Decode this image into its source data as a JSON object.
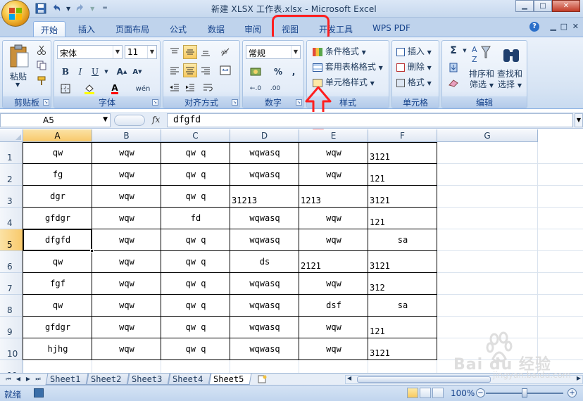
{
  "window": {
    "title": "新建 XLSX 工作表.xlsx - Microsoft Excel"
  },
  "tabs": [
    {
      "label": "开始",
      "active": true
    },
    {
      "label": "插入"
    },
    {
      "label": "页面布局"
    },
    {
      "label": "公式"
    },
    {
      "label": "数据"
    },
    {
      "label": "审阅"
    },
    {
      "label": "视图"
    },
    {
      "label": "开发工具"
    },
    {
      "label": "WPS PDF"
    }
  ],
  "ribbon": {
    "clipboard": {
      "paste_label": "粘贴",
      "group_label": "剪贴板"
    },
    "font": {
      "font_name": "宋体",
      "font_size": "11",
      "group_label": "字体"
    },
    "alignment": {
      "group_label": "对齐方式"
    },
    "number": {
      "format": "常规",
      "group_label": "数字"
    },
    "styles": {
      "conditional": "条件格式",
      "table_format": "套用表格格式",
      "cell_styles": "单元格样式",
      "group_label": "样式"
    },
    "cells": {
      "insert": "插入",
      "delete": "删除",
      "format": "格式",
      "group_label": "单元格"
    },
    "editing": {
      "sort_line1": "排序和",
      "sort_line2": "筛选",
      "find_line1": "查找和",
      "find_line2": "选择",
      "group_label": "编辑"
    }
  },
  "formula_bar": {
    "name_box": "A5",
    "fx": "fx",
    "formula": "dfgfd"
  },
  "columns": [
    "A",
    "B",
    "C",
    "D",
    "E",
    "F",
    "G"
  ],
  "selected_column": "A",
  "selected_row": "5",
  "rows": [
    {
      "num": "1",
      "cells": [
        "qw",
        "wqw",
        "qw q",
        "wqwasq",
        "wqw",
        "3121"
      ]
    },
    {
      "num": "2",
      "cells": [
        "fg",
        "wqw",
        "qw q",
        "wqwasq",
        "wqw",
        "121"
      ]
    },
    {
      "num": "3",
      "cells": [
        "dgr",
        "wqw",
        "qw q",
        "31213",
        "1213",
        "3121"
      ]
    },
    {
      "num": "4",
      "cells": [
        "gfdgr",
        "wqw",
        "fd",
        "wqwasq",
        "wqw",
        "121"
      ]
    },
    {
      "num": "5",
      "cells": [
        "dfgfd",
        "wqw",
        "qw q",
        "wqwasq",
        "wqw",
        "sa"
      ]
    },
    {
      "num": "6",
      "cells": [
        "qw",
        "wqw",
        "qw q",
        "ds",
        "2121",
        "3121"
      ]
    },
    {
      "num": "7",
      "cells": [
        "fgf",
        "wqw",
        "qw q",
        "wqwasq",
        "wqw",
        "312"
      ]
    },
    {
      "num": "8",
      "cells": [
        "qw",
        "wqw",
        "qw q",
        "wqwasq",
        "dsf",
        "sa"
      ]
    },
    {
      "num": "9",
      "cells": [
        "gfdgr",
        "wqw",
        "qw q",
        "wqwasq",
        "wqw",
        "121"
      ]
    },
    {
      "num": "10",
      "cells": [
        "hjhg",
        "wqw",
        "qw q",
        "wqwasq",
        "wqw",
        "3121"
      ]
    },
    {
      "num": "11",
      "cells": [
        "",
        "",
        "",
        "",
        "",
        ""
      ]
    }
  ],
  "sheets": [
    "Sheet1",
    "Sheet2",
    "Sheet3",
    "Sheet4",
    "Sheet5"
  ],
  "active_sheet": "Sheet5",
  "status": {
    "ready": "就绪",
    "zoom": "100%"
  },
  "watermark": {
    "brand": "Bai du 经验",
    "url": "jingyan.baidu.com"
  },
  "colors": {
    "annotation": "#ff1f1f",
    "ribbon_text": "#15428b"
  }
}
